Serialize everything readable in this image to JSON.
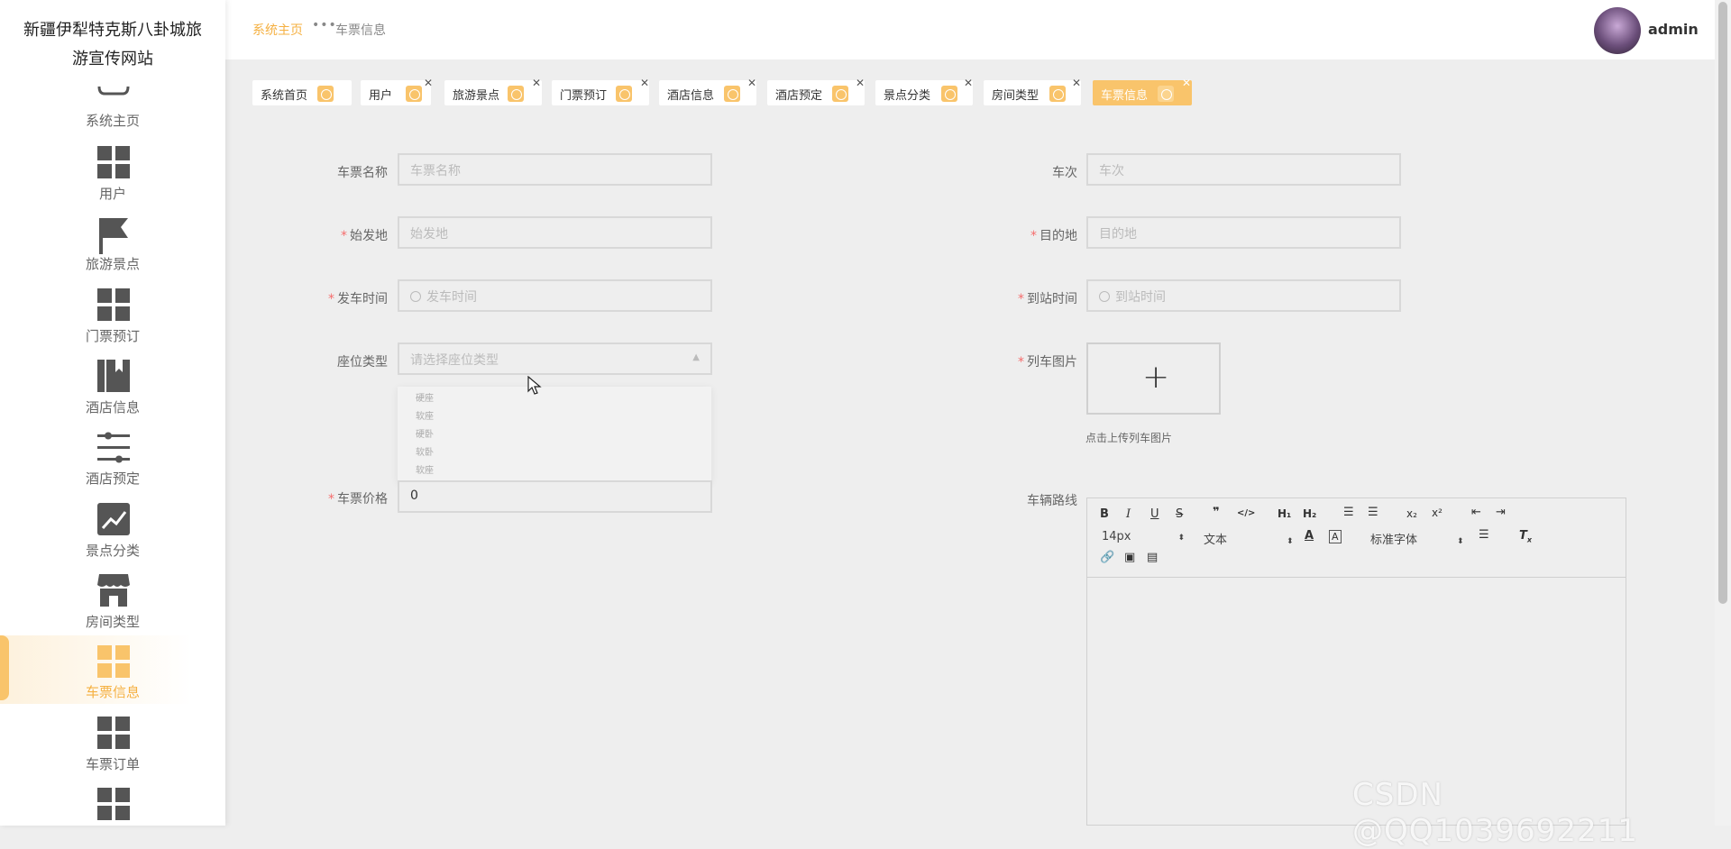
{
  "brand": {
    "line1": "新疆伊犁特克斯八卦城旅",
    "line2": "游宣传网站"
  },
  "sidebar": {
    "items": [
      {
        "label": "系统主页",
        "icon": "home-icon"
      },
      {
        "label": "用户",
        "icon": "grid-icon"
      },
      {
        "label": "旅游景点",
        "icon": "flag-icon"
      },
      {
        "label": "门票预订",
        "icon": "grid-icon"
      },
      {
        "label": "酒店信息",
        "icon": "book-icon"
      },
      {
        "label": "酒店预定",
        "icon": "sliders-icon"
      },
      {
        "label": "景点分类",
        "icon": "chart-icon"
      },
      {
        "label": "房间类型",
        "icon": "shop-icon"
      },
      {
        "label": "车票信息",
        "icon": "grid-icon",
        "active": true
      },
      {
        "label": "车票订单",
        "icon": "grid-icon"
      },
      {
        "label": "",
        "icon": "grid-icon"
      }
    ]
  },
  "topbar": {
    "crumb_home": "系统主页",
    "crumb_current": "车票信息",
    "username": "admin"
  },
  "tabs": [
    {
      "label": "系统首页",
      "closable": false
    },
    {
      "label": "用户",
      "closable": true
    },
    {
      "label": "旅游景点",
      "closable": true
    },
    {
      "label": "门票预订",
      "closable": true
    },
    {
      "label": "酒店信息",
      "closable": true
    },
    {
      "label": "酒店预定",
      "closable": true
    },
    {
      "label": "景点分类",
      "closable": true
    },
    {
      "label": "房间类型",
      "closable": true
    },
    {
      "label": "车票信息",
      "closable": true,
      "active": true
    }
  ],
  "form": {
    "ticket_name": {
      "label": "车票名称",
      "placeholder": "车票名称",
      "required": false
    },
    "train_no": {
      "label": "车次",
      "placeholder": "车次",
      "required": false
    },
    "origin": {
      "label": "始发地",
      "placeholder": "始发地",
      "required": true
    },
    "destination": {
      "label": "目的地",
      "placeholder": "目的地",
      "required": true
    },
    "depart_time": {
      "label": "发车时间",
      "placeholder": "发车时间",
      "required": true
    },
    "arrive_time": {
      "label": "到站时间",
      "placeholder": "到站时间",
      "required": true
    },
    "seat_type": {
      "label": "座位类型",
      "placeholder": "请选择座位类型",
      "required": false
    },
    "train_image": {
      "label": "列车图片",
      "hint": "点击上传列车图片",
      "required": true
    },
    "price": {
      "label": "车票价格",
      "value": "0",
      "required": true
    },
    "route": {
      "label": "车辆路线",
      "required": false
    }
  },
  "seat_options": [
    "硬座",
    "软座",
    "硬卧",
    "软卧",
    "软座"
  ],
  "editor": {
    "font_size": "14px",
    "header_select": "文本",
    "font_family": "标准字体"
  },
  "watermark": "CSDN @QQ1039692211",
  "colors": {
    "accent": "#f9c46b",
    "accent_text": "#f5b041",
    "required": "#f56c6c"
  }
}
